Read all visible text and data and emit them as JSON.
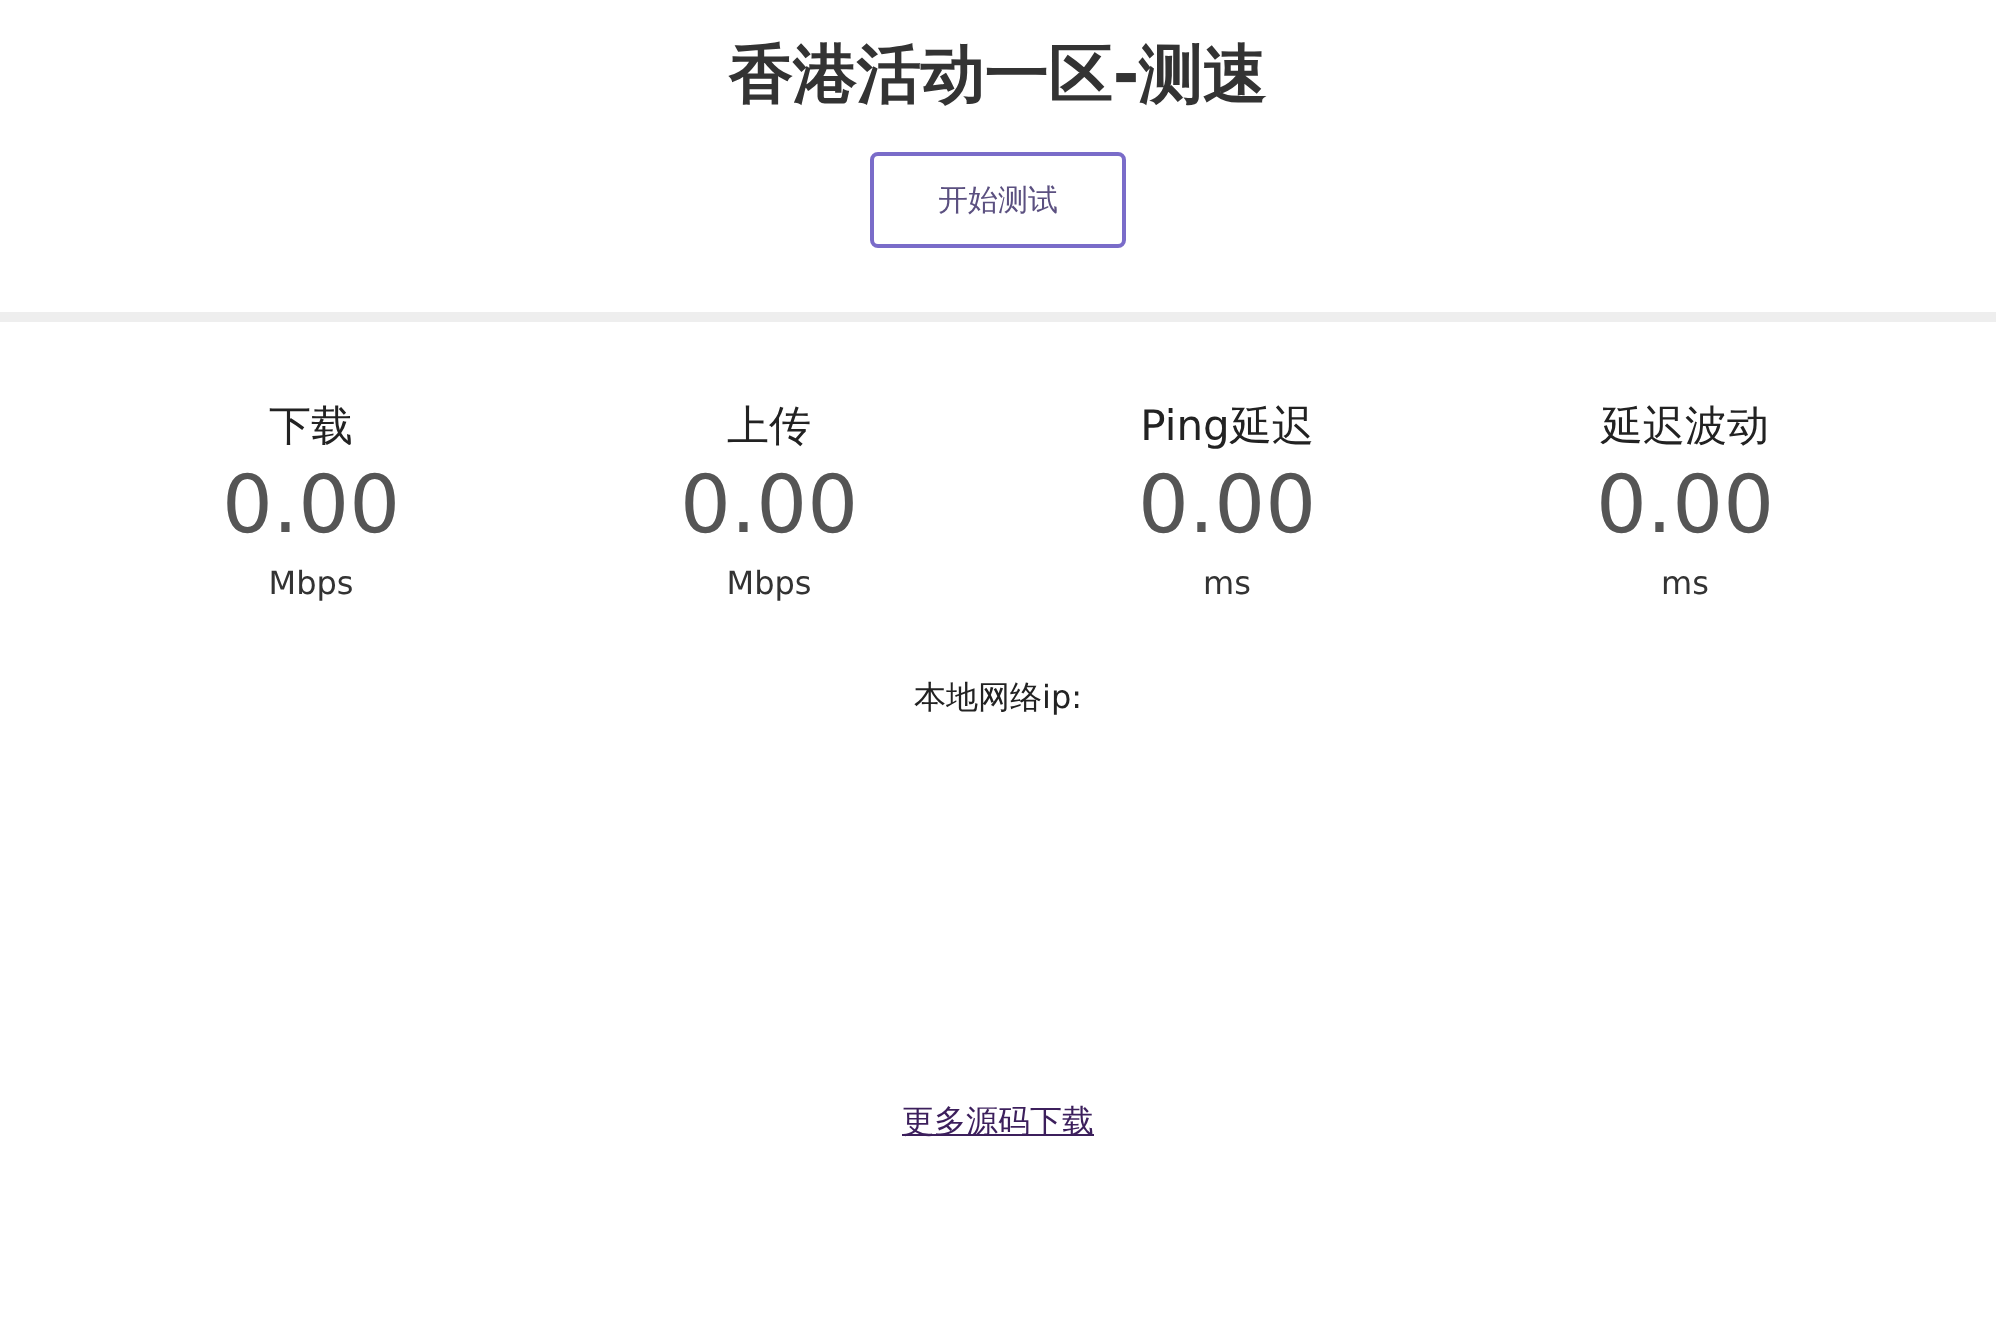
{
  "title": "香港活动一区-测速",
  "start_button": {
    "label": "开始测试"
  },
  "metrics": [
    {
      "label": "下载",
      "value": "0.00",
      "unit": "Mbps"
    },
    {
      "label": "上传",
      "value": "0.00",
      "unit": "Mbps"
    },
    {
      "label": "Ping延迟",
      "value": "0.00",
      "unit": "ms"
    },
    {
      "label": "延迟波动",
      "value": "0.00",
      "unit": "ms"
    }
  ],
  "ip_label": "本地网络ip:",
  "footer_link": "更多源码下载"
}
